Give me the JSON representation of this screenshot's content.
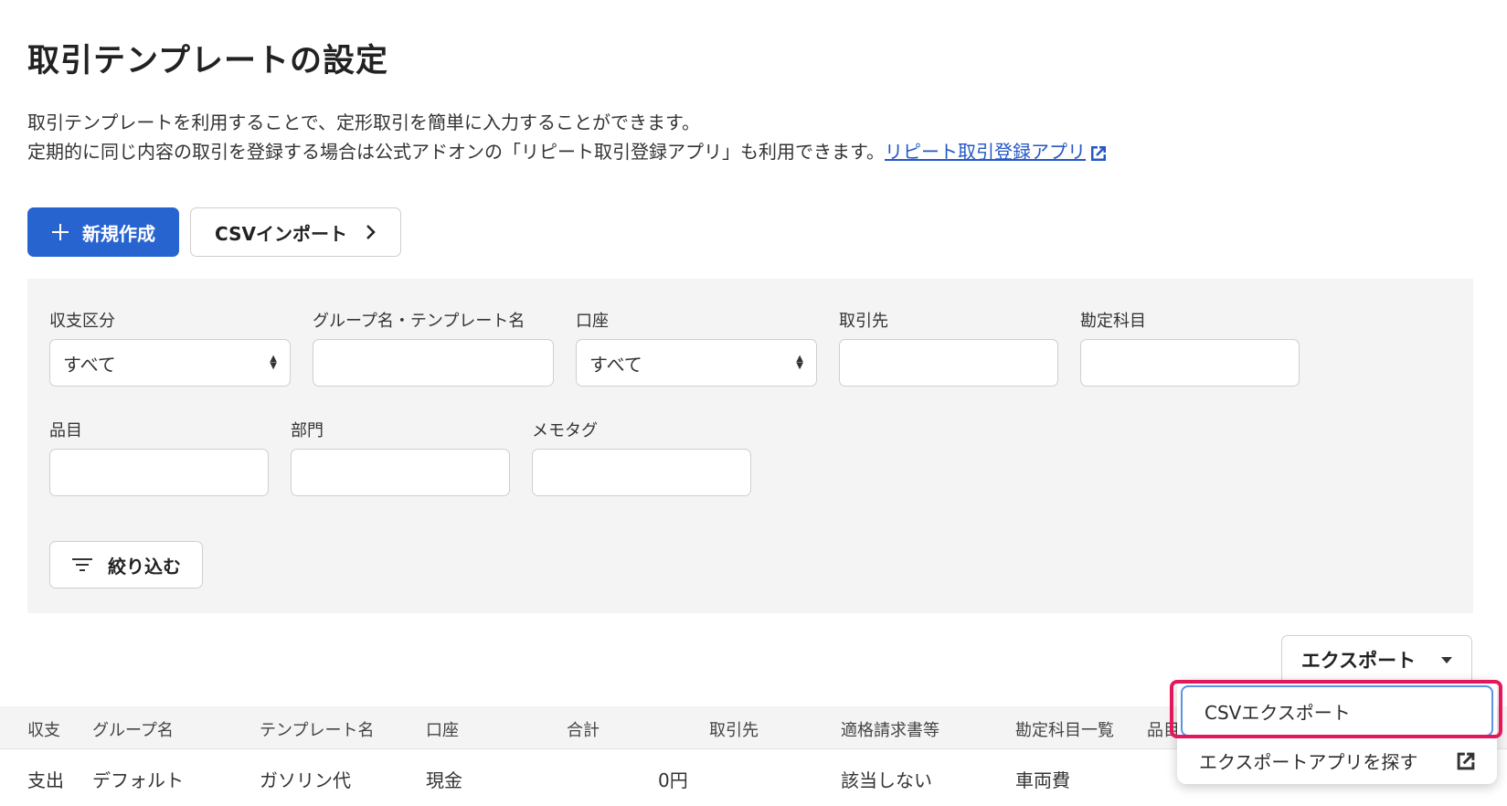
{
  "page": {
    "title": "取引テンプレートの設定",
    "description_line1": "取引テンプレートを利用することで、定形取引を簡単に入力することができます。",
    "description_line2": "定期的に同じ内容の取引を登録する場合は公式アドオンの「リピート取引登録アプリ」も利用できます。",
    "link_text": "リピート取引登録アプリ"
  },
  "actions": {
    "new_label": "新規作成",
    "csv_import_label": "CSVインポート"
  },
  "filters": {
    "income_type": {
      "label": "収支区分",
      "value": "すべて"
    },
    "group_template": {
      "label": "グループ名・テンプレート名",
      "value": ""
    },
    "account": {
      "label": "口座",
      "value": "すべて"
    },
    "partner": {
      "label": "取引先",
      "value": ""
    },
    "account_item": {
      "label": "勘定科目",
      "value": ""
    },
    "item": {
      "label": "品目",
      "value": ""
    },
    "section": {
      "label": "部門",
      "value": ""
    },
    "memo_tag": {
      "label": "メモタグ",
      "value": ""
    },
    "apply_label": "絞り込む"
  },
  "export": {
    "label": "エクスポート",
    "menu": [
      {
        "label": "CSVエクスポート"
      },
      {
        "label": "エクスポートアプリを探す"
      }
    ]
  },
  "table": {
    "columns": [
      "収支",
      "グループ名",
      "テンプレート名",
      "口座",
      "合計",
      "取引先",
      "適格請求書等",
      "勘定科目一覧",
      "品目"
    ],
    "rows": [
      {
        "type": "支出",
        "group": "デフォルト",
        "template": "ガソリン代",
        "account": "現金",
        "total": "0円",
        "partner": "",
        "invoice": "該当しない",
        "account_items": "車両費"
      }
    ]
  },
  "colors": {
    "primary": "#2864d0",
    "highlight": "#e5175c",
    "link": "#2457c5"
  }
}
